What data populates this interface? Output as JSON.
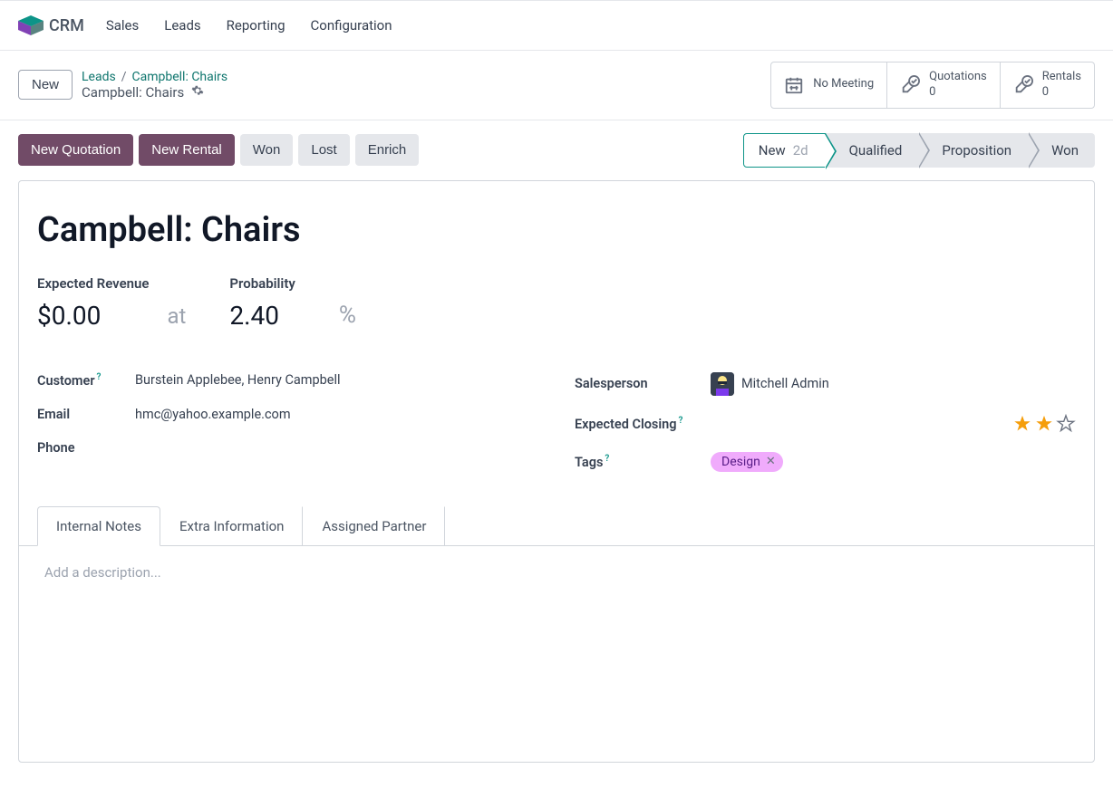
{
  "app_name": "CRM",
  "nav": [
    "Sales",
    "Leads",
    "Reporting",
    "Configuration"
  ],
  "controls": {
    "new_btn": "New",
    "breadcrumb_root": "Leads",
    "breadcrumb_current": "Campbell: Chairs",
    "page_title": "Campbell: Chairs"
  },
  "stat_boxes": {
    "meeting": {
      "label": "No Meeting"
    },
    "quotations": {
      "label": "Quotations",
      "count": "0"
    },
    "rentals": {
      "label": "Rentals",
      "count": "0"
    }
  },
  "action_buttons": {
    "new_quotation": "New Quotation",
    "new_rental": "New Rental",
    "won": "Won",
    "lost": "Lost",
    "enrich": "Enrich"
  },
  "stages": [
    {
      "label": "New",
      "sub": "2d",
      "active": true
    },
    {
      "label": "Qualified"
    },
    {
      "label": "Proposition"
    },
    {
      "label": "Won"
    }
  ],
  "lead": {
    "title": "Campbell: Chairs",
    "expected_revenue_label": "Expected Revenue",
    "expected_revenue": "$0.00",
    "at": "at",
    "probability_label": "Probability",
    "probability": "2.40",
    "pct": "%",
    "customer_label": "Customer",
    "customer": "Burstein Applebee, Henry Campbell",
    "email_label": "Email",
    "email": "hmc@yahoo.example.com",
    "phone_label": "Phone",
    "phone": "",
    "salesperson_label": "Salesperson",
    "salesperson": "Mitchell Admin",
    "expected_closing_label": "Expected Closing",
    "expected_closing": "",
    "priority_stars": 2,
    "tags_label": "Tags",
    "tags": [
      "Design"
    ]
  },
  "tabs": [
    "Internal Notes",
    "Extra Information",
    "Assigned Partner"
  ],
  "tab_active": 0,
  "description_placeholder": "Add a description..."
}
